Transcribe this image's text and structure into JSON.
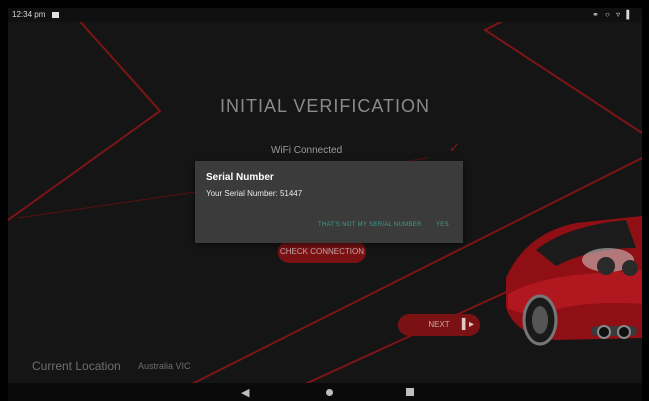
{
  "statusbar": {
    "time": "12:34 pm",
    "icons": "⚭ ○ ▿ ▌"
  },
  "screen": {
    "title": "INITIAL VERIFICATION",
    "wifi_label": "WiFi Connected",
    "check_glyph": "✓",
    "check_connection_label": "CHECK CONNECTION",
    "next_label": "NEXT",
    "next_icon": "▌▸",
    "location_label": "Current Location",
    "location_value": "Australia VIC"
  },
  "dialog": {
    "title": "Serial Number",
    "message": "Your Serial Number: 51447",
    "button_wrong": "THAT'S NOT MY SERIAL NUMBER",
    "button_yes": "YES"
  },
  "navbar": {
    "back_glyph": "◀"
  },
  "colors": {
    "background": "#151515",
    "accent_red": "#7a1214",
    "dialog": "#3b3b3b",
    "dialog_button": "#3f9c8e"
  }
}
